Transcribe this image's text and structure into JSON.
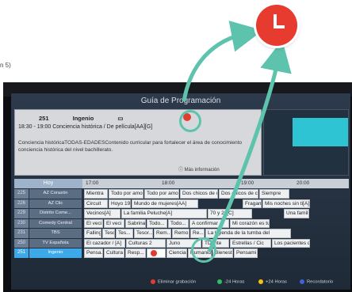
{
  "page_fragment": "n 5)",
  "screen": {
    "title": "Guía de Programación"
  },
  "info": {
    "channel_number": "251",
    "channel_name": "Ingenio",
    "time_and_title": "18:30 - 19:00  Conciencia histórica / De película[AA][G]",
    "description": "Conciencia históricaTODAS-EDADESContenido curricular para fortalecer el área de conocimiento conciencia histórica del nivel bachillerato.",
    "more_info": "Más información"
  },
  "grid": {
    "today": "Hoy",
    "times": [
      "17:00",
      "18:00",
      "19:00",
      "20:00"
    ],
    "channels": [
      {
        "num": "225",
        "name": "AZ Corazón",
        "programs": [
          "Mientra",
          "Todo por amor /",
          "Todo por amor /",
          "Dos chicos de c",
          "Dos chicos de c",
          "Siempre"
        ]
      },
      {
        "num": "226",
        "name": "AZ Clic",
        "programs": [
          "Circuit",
          "Hoyo 19",
          "Mundo de mujeres[AA]",
          "Fragame",
          "Mis noches sin ti[A]"
        ]
      },
      {
        "num": "229",
        "name": "Distrito Come...",
        "programs": [
          "Vecinos[A]",
          "La familia Peluche[A]",
          "70 y 20[C]",
          "Una familia d"
        ]
      },
      {
        "num": "230",
        "name": "Comedy Central",
        "programs": [
          "El veci",
          "El veci",
          "Sabrina",
          "Todo...",
          "Todo...",
          "A confirmar",
          "Mi corazón es tuyo"
        ]
      },
      {
        "num": "231",
        "name": "TBS",
        "programs": [
          "Falling",
          "Tesor...",
          "Tes...",
          "Tesor...",
          "Rem...",
          "Remo...",
          "Re...",
          "La leyenda de la tumba del"
        ]
      },
      {
        "num": "250",
        "name": "TV Española",
        "programs": [
          "El cazador / [A]",
          "Culturas 2",
          "Juno",
          "TD Inte",
          "Estrellas / Cic",
          "Los pacientes d"
        ]
      },
      {
        "num": "251",
        "name": "Ingenio",
        "programs": [
          "Pensa...",
          "Cultura",
          "Resp...",
          "",
          "Ciencia",
          "Humanid",
          "Bienest",
          "Pensami"
        ]
      }
    ]
  },
  "legend": [
    {
      "label": "Eliminar grabación",
      "color": "#e23c2f"
    },
    {
      "label": "-24 Horas",
      "color": "#2fbf63"
    },
    {
      "label": "+24 Horas",
      "color": "#f1c40f"
    },
    {
      "label": "Recordatorio",
      "color": "#3f63d6"
    }
  ],
  "colors": {
    "accent_ring": "#5ec3ad",
    "record_red": "#e83b2f",
    "selected_blue": "#3ea9e8"
  }
}
